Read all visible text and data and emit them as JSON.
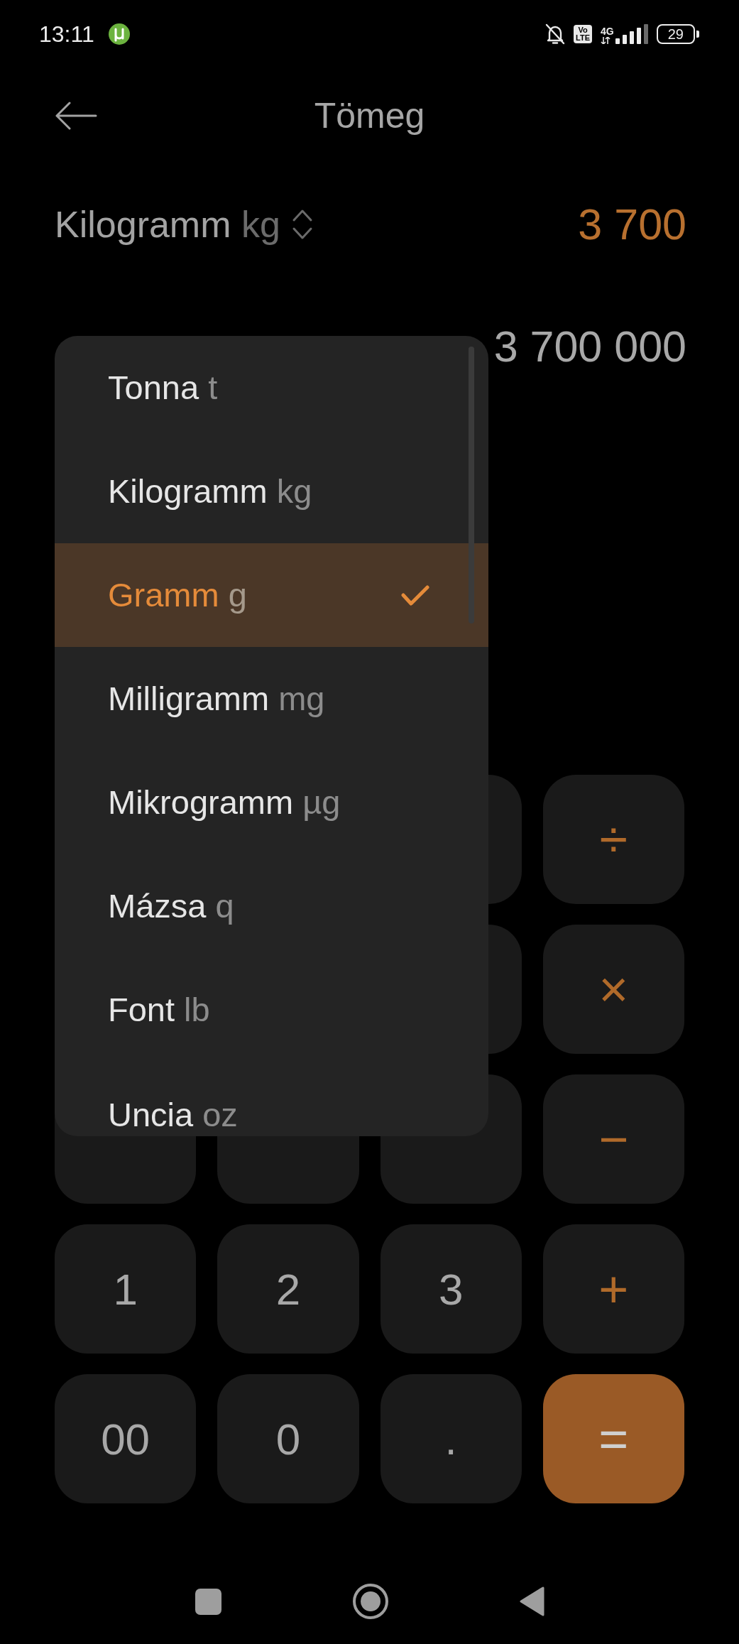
{
  "status_bar": {
    "time": "13:11",
    "volte_badge": [
      "Vo",
      "LTE"
    ],
    "network_type": "4G",
    "battery": "29"
  },
  "header": {
    "title": "Tömeg"
  },
  "conversions": [
    {
      "unit": "Kilogramm",
      "symbol": "kg",
      "value": "3 700",
      "active": true
    },
    {
      "value": "3 700 000",
      "active": false
    }
  ],
  "unit_menu": {
    "items": [
      {
        "unit": "Tonna",
        "symbol": "t",
        "selected": false
      },
      {
        "unit": "Kilogramm",
        "symbol": "kg",
        "selected": false
      },
      {
        "unit": "Gramm",
        "symbol": "g",
        "selected": true
      },
      {
        "unit": "Milligramm",
        "symbol": "mg",
        "selected": false
      },
      {
        "unit": "Mikrogramm",
        "symbol": "µg",
        "selected": false
      },
      {
        "unit": "Mázsa",
        "symbol": "q",
        "selected": false
      },
      {
        "unit": "Font",
        "symbol": "lb",
        "selected": false
      },
      {
        "unit": "Uncia",
        "symbol": "oz",
        "selected": false
      }
    ]
  },
  "keypad": {
    "rows": [
      [
        {
          "kind": "covered"
        },
        {
          "kind": "operator",
          "label": "÷"
        }
      ],
      [
        {
          "kind": "covered"
        },
        {
          "kind": "operator",
          "label": "×"
        }
      ],
      [
        {
          "kind": "covered"
        },
        {
          "kind": "covered"
        },
        {
          "kind": "covered"
        },
        {
          "kind": "operator",
          "label": "−"
        }
      ],
      [
        {
          "kind": "digit",
          "label": "1"
        },
        {
          "kind": "digit",
          "label": "2"
        },
        {
          "kind": "digit",
          "label": "3"
        },
        {
          "kind": "operator",
          "label": "+"
        }
      ],
      [
        {
          "kind": "digit",
          "label": "00"
        },
        {
          "kind": "digit",
          "label": "0"
        },
        {
          "kind": "digit",
          "label": "."
        },
        {
          "kind": "equals",
          "label": "="
        }
      ]
    ]
  }
}
